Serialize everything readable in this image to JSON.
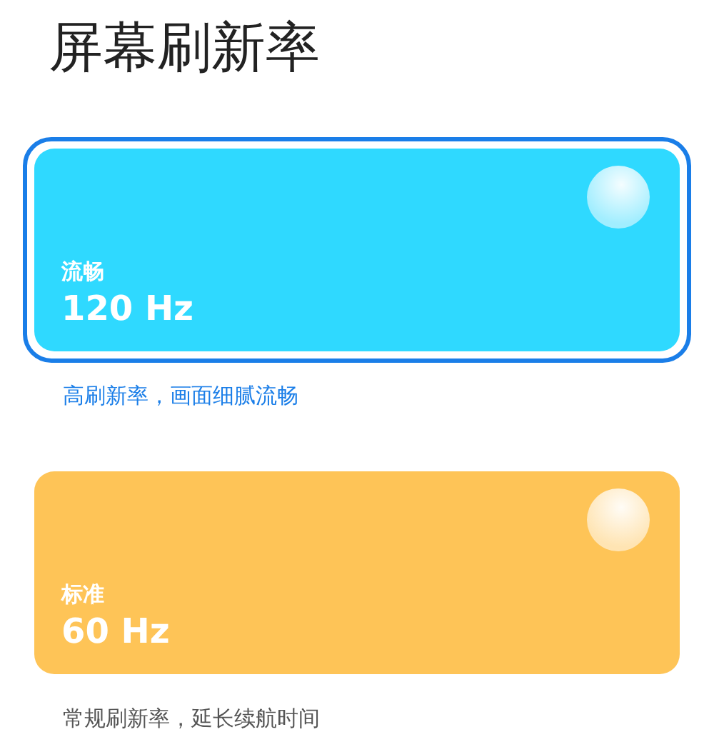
{
  "title": "屏幕刷新率",
  "options": [
    {
      "label": "流畅",
      "value": "120 Hz",
      "description": "高刷新率，画面细腻流畅",
      "selected": true,
      "color": "#2fd9ff"
    },
    {
      "label": "标准",
      "value": "60 Hz",
      "description": "常规刷新率，延长续航时间",
      "selected": false,
      "color": "#fec457"
    }
  ]
}
